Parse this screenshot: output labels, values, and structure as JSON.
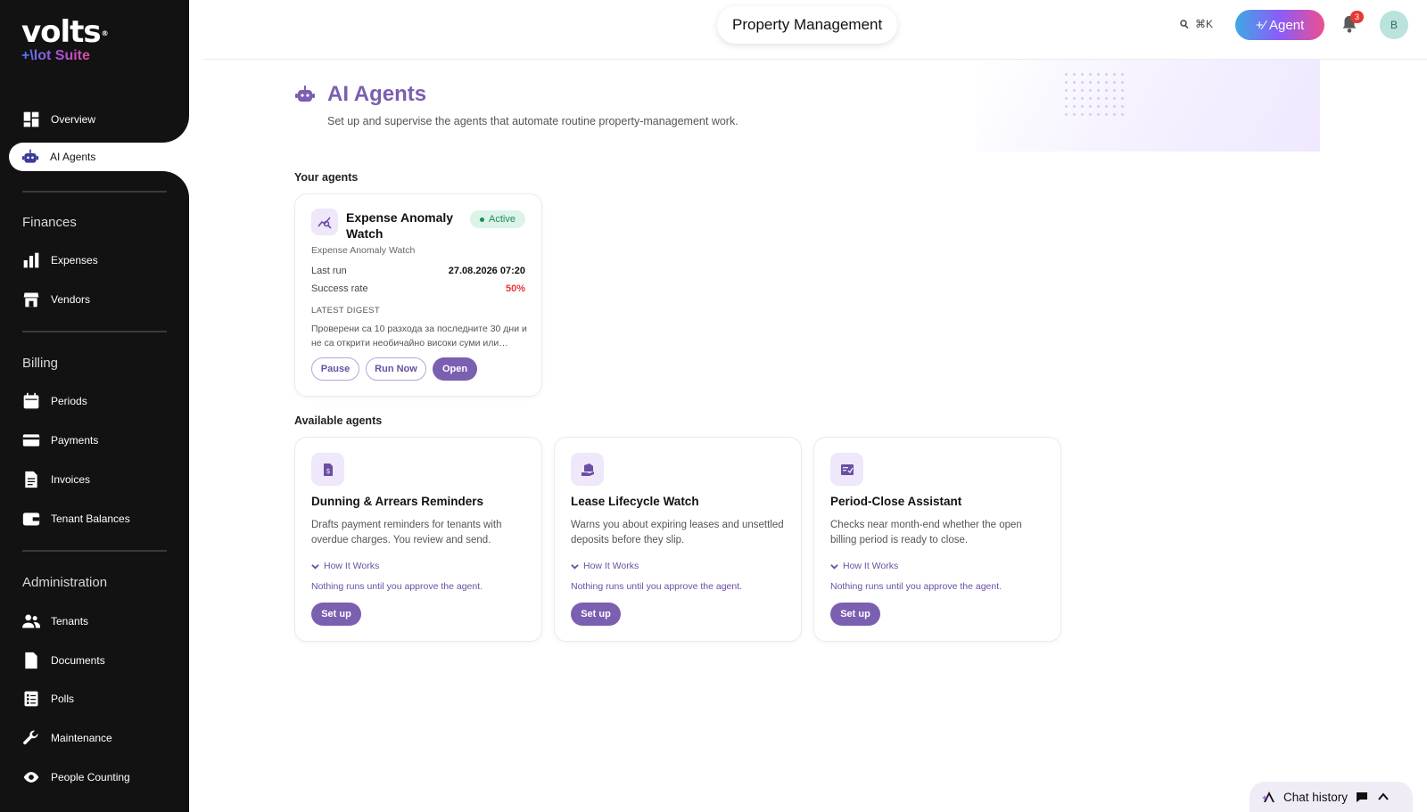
{
  "brand": {
    "name": "volts",
    "suite": "+\\lot Suite"
  },
  "header": {
    "app_title": "Property Management",
    "search_shortcut": "⌘K",
    "agent_button": "Agent",
    "notifications_count": "3",
    "avatar_initial": "B"
  },
  "sidebar": {
    "overview": "Overview",
    "ai_agents": "AI Agents",
    "finances_title": "Finances",
    "expenses": "Expenses",
    "vendors": "Vendors",
    "billing_title": "Billing",
    "periods": "Periods",
    "payments": "Payments",
    "invoices": "Invoices",
    "tenant_balances": "Tenant Balances",
    "administration_title": "Administration",
    "tenants": "Tenants",
    "documents": "Documents",
    "polls": "Polls",
    "maintenance": "Maintenance",
    "people_counting": "People Counting"
  },
  "page": {
    "title": "AI Agents",
    "subtitle": "Set up and supervise the agents that automate routine property-management work.",
    "your_agents_label": "Your agents",
    "available_agents_label": "Available agents"
  },
  "active_agent": {
    "title": "Expense Anomaly Watch",
    "status": "Active",
    "subtitle": "Expense Anomaly Watch",
    "last_run_label": "Last run",
    "last_run_value": "27.08.2026 07:20",
    "success_label": "Success rate",
    "success_value": "50%",
    "digest_heading": "LATEST DIGEST",
    "digest_text": "Проверени са 10 разхода за последните 30 дни и не са открити необичайно високи суми или…",
    "pause": "Pause",
    "run_now": "Run Now",
    "open": "Open"
  },
  "available": [
    {
      "icon": "invoice-dollar-icon",
      "title": "Dunning & Arrears Reminders",
      "desc": "Drafts payment reminders for tenants with overdue charges. You review and send.",
      "how": "How It Works",
      "note": "Nothing runs until you approve the agent.",
      "button": "Set up"
    },
    {
      "icon": "lease-hand-icon",
      "title": "Lease Lifecycle Watch",
      "desc": "Warns you about expiring leases and unsettled deposits before they slip.",
      "how": "How It Works",
      "note": "Nothing runs until you approve the agent.",
      "button": "Set up"
    },
    {
      "icon": "checklist-icon",
      "title": "Period-Close Assistant",
      "desc": "Checks near month-end whether the open billing period is ready to close.",
      "how": "How It Works",
      "note": "Nothing runs until you approve the agent.",
      "button": "Set up"
    }
  ],
  "chat": {
    "label": "Chat history"
  }
}
